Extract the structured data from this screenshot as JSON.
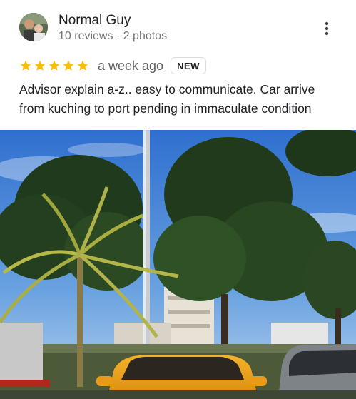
{
  "review": {
    "reviewer_name": "Normal Guy",
    "reviewer_meta": "10 reviews · 2 photos",
    "rating": 5,
    "rating_max": 5,
    "time": "a week ago",
    "badge": "NEW",
    "text": "Advisor explain a-z.. easy to communicate. Car arrive from kuching to port pending in immaculate condition"
  },
  "icons": {
    "star": "star-icon",
    "more": "more-vert-icon"
  },
  "colors": {
    "star": "#fbbc04",
    "sky": "#3f7fd4",
    "car": "#f0a81c"
  }
}
